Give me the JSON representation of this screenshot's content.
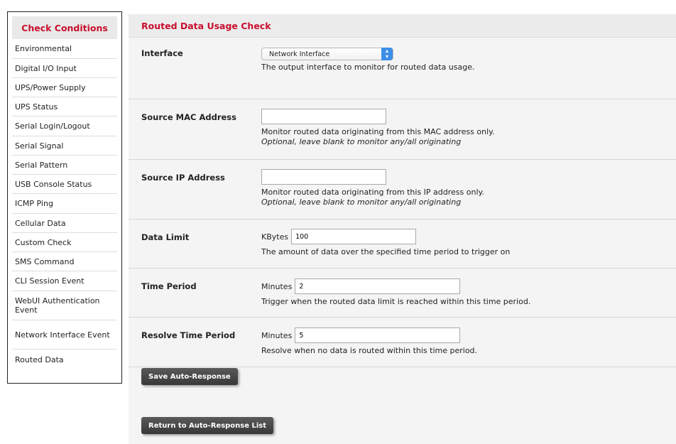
{
  "sidebar": {
    "title": "Check Conditions",
    "items": [
      {
        "label": "Environmental"
      },
      {
        "label": "Digital I/O Input"
      },
      {
        "label": "UPS/Power Supply"
      },
      {
        "label": "UPS Status"
      },
      {
        "label": "Serial Login/Logout"
      },
      {
        "label": "Serial Signal"
      },
      {
        "label": "Serial Pattern"
      },
      {
        "label": "USB Console Status"
      },
      {
        "label": "ICMP Ping"
      },
      {
        "label": "Cellular Data"
      },
      {
        "label": "Custom Check"
      },
      {
        "label": "SMS Command"
      },
      {
        "label": "CLI Session Event"
      },
      {
        "label": "WebUI Authentication Event"
      },
      {
        "label": "Network Interface Event"
      },
      {
        "label": "Routed Data"
      }
    ]
  },
  "main": {
    "title": "Routed Data Usage Check",
    "interface": {
      "label": "Interface",
      "selected": "Network Interface",
      "help": "The output interface to monitor for routed data usage."
    },
    "source_mac": {
      "label": "Source MAC Address",
      "value": "",
      "help": "Monitor routed data originating from this MAC address only.",
      "note": "Optional, leave blank to monitor any/all originating"
    },
    "source_ip": {
      "label": "Source IP Address",
      "value": "",
      "help": "Monitor routed data originating from this IP address only.",
      "note": "Optional, leave blank to monitor any/all originating"
    },
    "data_limit": {
      "label": "Data Limit",
      "unit": "KBytes",
      "value": "100",
      "help": "The amount of data over the specified time period to trigger on"
    },
    "time_period": {
      "label": "Time Period",
      "unit": "Minutes",
      "value": "2",
      "help": "Trigger when the routed data limit is reached within this time period."
    },
    "resolve_time_period": {
      "label": "Resolve Time Period",
      "unit": "Minutes",
      "value": "5",
      "help": "Resolve when no data is routed within this time period."
    },
    "save_button": "Save Auto-Response",
    "return_button": "Return to Auto-Response List"
  },
  "colors": {
    "accent_red": "#c8102e",
    "select_blue": "#3d8ee8",
    "button_dark": "#3f3f3f"
  }
}
